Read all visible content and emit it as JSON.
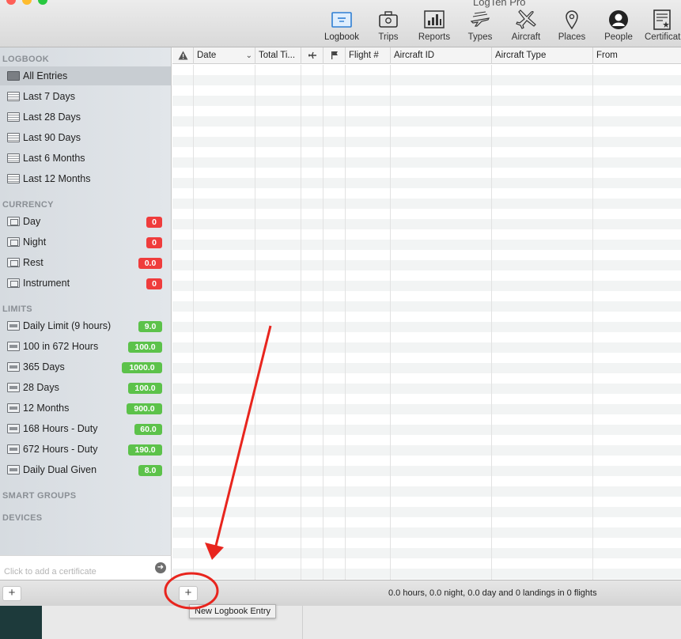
{
  "window": {
    "title": "LogTen Pro",
    "traffic_lights": [
      "#fe5f57",
      "#febc2e",
      "#28c840"
    ]
  },
  "toolbar": {
    "items": [
      {
        "label": "Logbook",
        "icon": "logbook-icon"
      },
      {
        "label": "Trips",
        "icon": "trips-icon"
      },
      {
        "label": "Reports",
        "icon": "reports-icon"
      },
      {
        "label": "Types",
        "icon": "types-icon"
      },
      {
        "label": "Aircraft",
        "icon": "aircraft-icon"
      },
      {
        "label": "Places",
        "icon": "places-icon"
      },
      {
        "label": "People",
        "icon": "people-icon"
      },
      {
        "label": "Certificat",
        "icon": "certificates-icon"
      }
    ]
  },
  "sidebar": {
    "sections": {
      "logbook": "LOGBOOK",
      "currency": "CURRENCY",
      "limits": "LIMITS",
      "smart_groups": "SMART GROUPS",
      "devices": "DEVICES"
    },
    "logbook_items": [
      {
        "label": "All Entries",
        "selected": true
      },
      {
        "label": "Last 7 Days"
      },
      {
        "label": "Last 28 Days"
      },
      {
        "label": "Last 90 Days"
      },
      {
        "label": "Last 6 Months"
      },
      {
        "label": "Last 12 Months"
      }
    ],
    "currency_items": [
      {
        "label": "Day",
        "badge": "0",
        "color": "#ef3c3c"
      },
      {
        "label": "Night",
        "badge": "0",
        "color": "#ef3c3c"
      },
      {
        "label": "Rest",
        "badge": "0.0",
        "color": "#ef3c3c"
      },
      {
        "label": "Instrument",
        "badge": "0",
        "color": "#ef3c3c"
      }
    ],
    "limit_items": [
      {
        "label": "Daily Limit (9 hours)",
        "badge": "9.0",
        "color": "#5cc24a"
      },
      {
        "label": "100 in 672 Hours",
        "badge": "100.0",
        "color": "#5cc24a"
      },
      {
        "label": "365 Days",
        "badge": "1000.0",
        "color": "#5cc24a"
      },
      {
        "label": "28 Days",
        "badge": "100.0",
        "color": "#5cc24a"
      },
      {
        "label": "12 Months",
        "badge": "900.0",
        "color": "#5cc24a"
      },
      {
        "label": "168 Hours - Duty",
        "badge": "60.0",
        "color": "#5cc24a"
      },
      {
        "label": "672 Hours - Duty",
        "badge": "190.0",
        "color": "#5cc24a"
      },
      {
        "label": "Daily Dual Given",
        "badge": "8.0",
        "color": "#5cc24a"
      }
    ],
    "certificate_placeholder": "Click to add a certificate"
  },
  "table": {
    "columns": [
      "",
      "Date",
      "Total Ti...",
      "",
      "",
      "Flight #",
      "Aircraft ID",
      "Aircraft Type",
      "From"
    ]
  },
  "bottom": {
    "add_label": "+",
    "new_entry_label": "+",
    "status": "0.0 hours, 0.0 night, 0.0 day and 0 landings in 0 flights",
    "tooltip": "New Logbook Entry"
  },
  "annotation": {
    "color": "#e8251e"
  }
}
